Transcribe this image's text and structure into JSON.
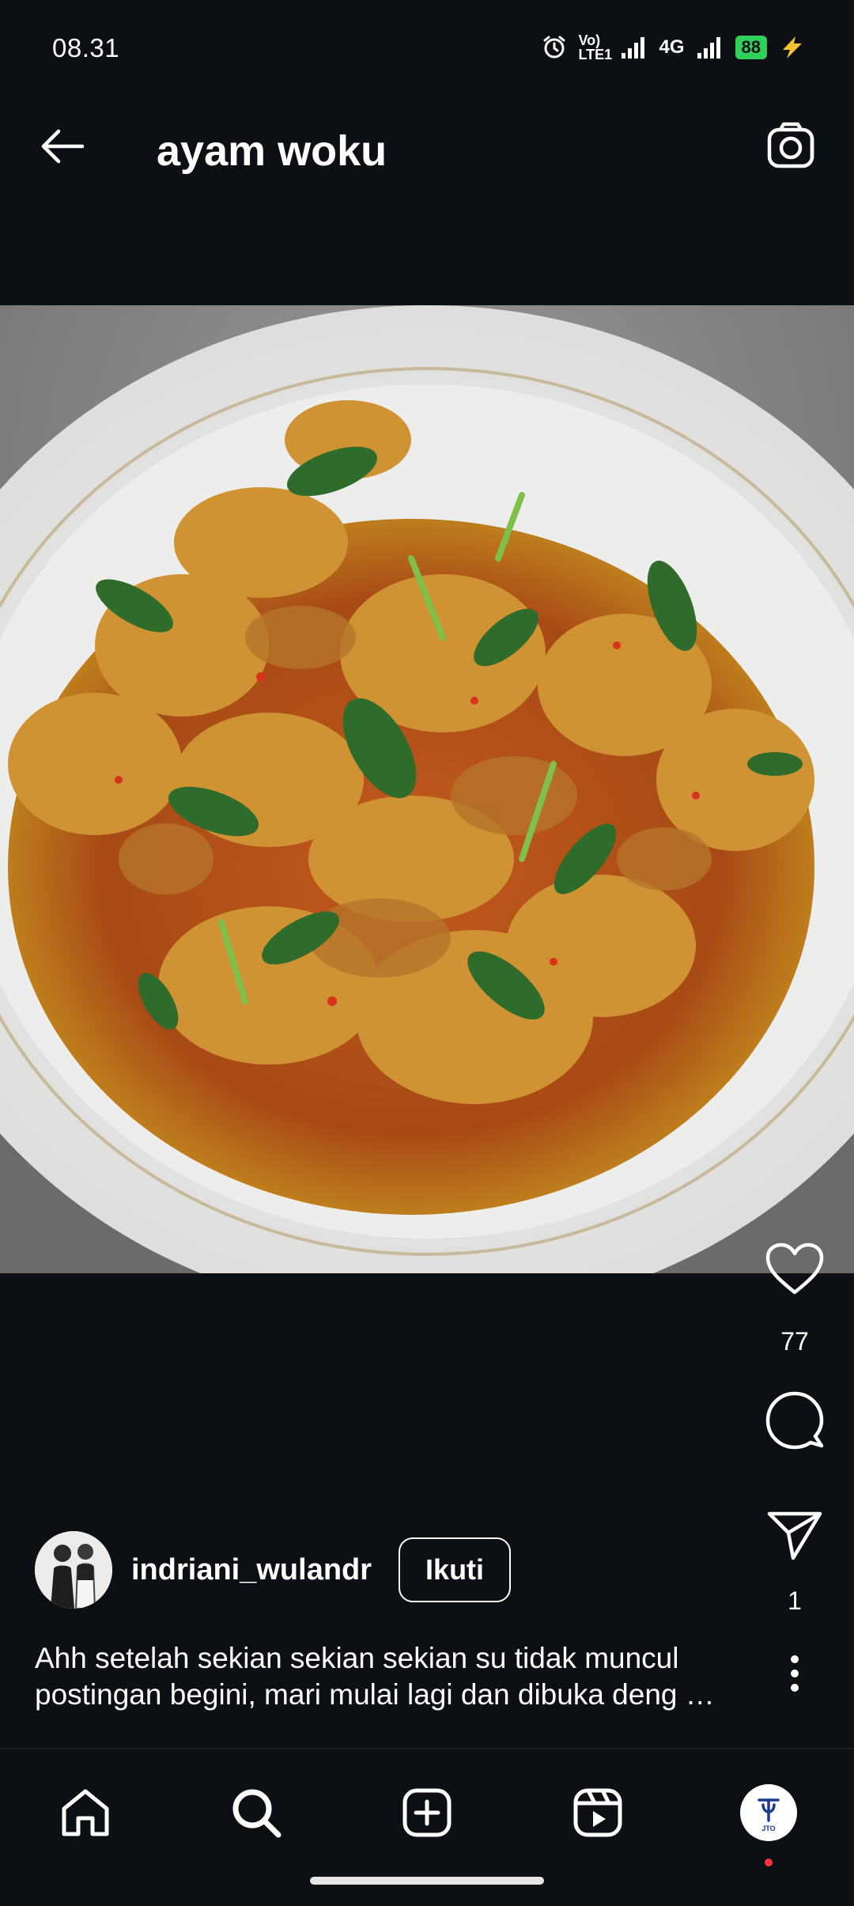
{
  "status_bar": {
    "time": "08.31",
    "volte_label": "Vo) LTE1",
    "network_label": "4G",
    "battery_level": "88",
    "icons": [
      "alarm-icon",
      "volte-icon",
      "signal-icon",
      "signal-icon",
      "battery-icon",
      "charging-icon"
    ]
  },
  "header": {
    "title": "ayam woku",
    "back_icon": "arrow-left-icon",
    "camera_icon": "camera-icon"
  },
  "post": {
    "image_subject": "ayam woku dish on white plate",
    "like_count": "77",
    "share_count": "1",
    "author": {
      "username": "indriani_wulandr",
      "follow_label": "Ikuti"
    },
    "caption_lines": [
      "Ahh setelah sekian sekian sekian su tidak muncul",
      "postingan begini, mari mulai lagi dan dibuka deng …"
    ]
  },
  "bottom_nav": {
    "items": [
      "home-icon",
      "search-icon",
      "create-icon",
      "reels-icon",
      "profile"
    ],
    "profile_label": "JTO"
  },
  "colors": {
    "background": "#0c0f14",
    "battery": "#2fd15a",
    "notification_dot": "#ff3040"
  }
}
